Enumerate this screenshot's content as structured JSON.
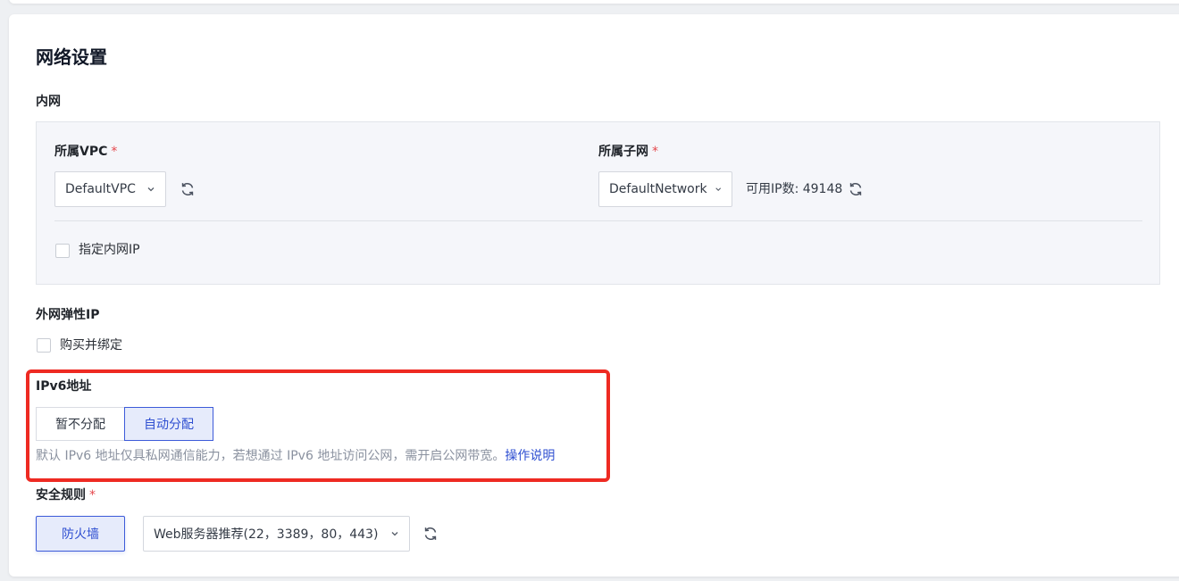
{
  "network": {
    "title": "网络设置",
    "intranet": {
      "label": "内网",
      "vpc": {
        "label": "所属VPC",
        "required_mark": "*",
        "value": "DefaultVPC"
      },
      "subnet": {
        "label": "所属子网",
        "required_mark": "*",
        "value": "DefaultNetwork",
        "available_ip": "可用IP数: 49148"
      },
      "specify_ip_label": "指定内网IP"
    },
    "eip": {
      "label": "外网弹性IP",
      "buy_bind_label": "购买并绑定"
    },
    "ipv6": {
      "label": "IPv6地址",
      "options": [
        "暂不分配",
        "自动分配"
      ],
      "selected": "自动分配",
      "help_text": "默认 IPv6 地址仅具私网通信能力，若想通过 IPv6 地址访问公网，需开启公网带宽。",
      "help_link": "操作说明"
    },
    "security": {
      "label": "安全规则",
      "required_mark": "*",
      "firewall_button": "防火墙",
      "rule_value": "Web服务器推荐(22，3389，80，443)"
    }
  },
  "colors": {
    "accent": "#2f4fd1",
    "highlight_border": "#ee2a22",
    "required": "#e5484d"
  }
}
